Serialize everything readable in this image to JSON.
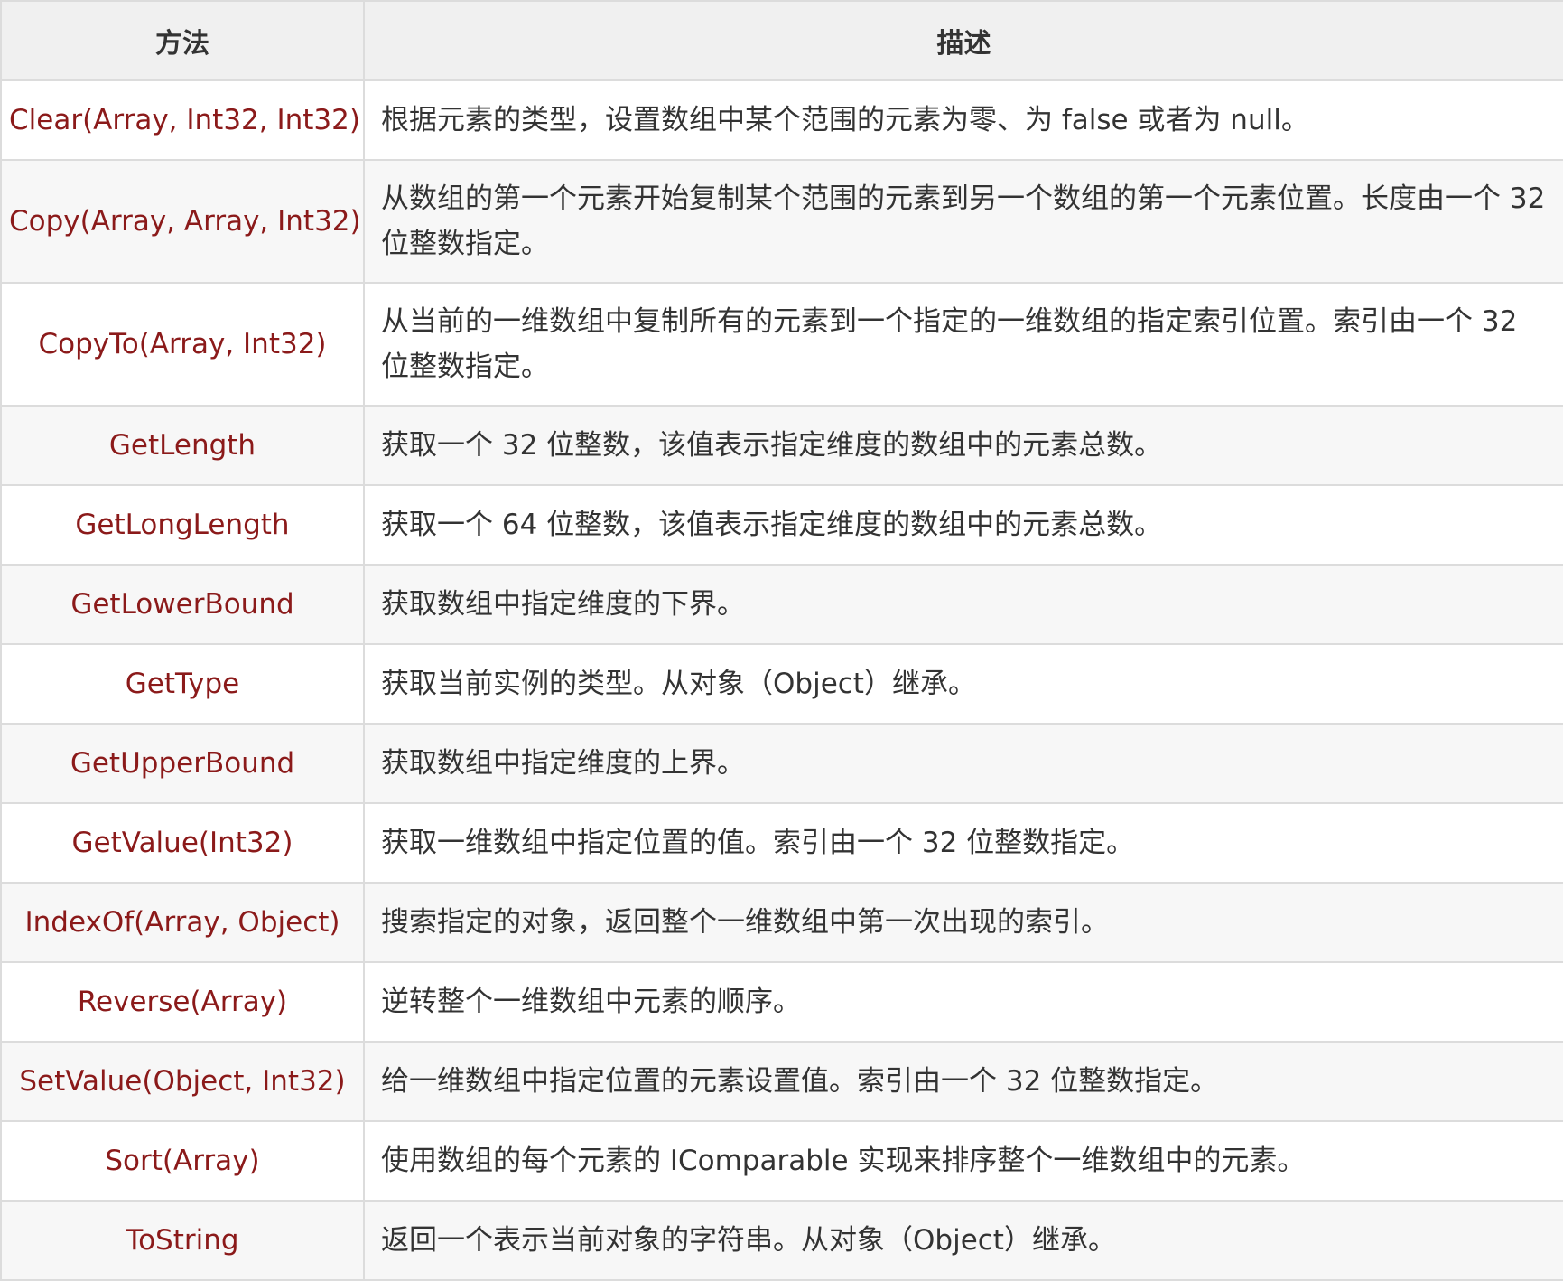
{
  "table": {
    "headers": [
      "方法",
      "描述"
    ],
    "rows": [
      {
        "method": "Clear(Array, Int32, Int32)",
        "description": "根据元素的类型，设置数组中某个范围的元素为零、为 false 或者为 null。"
      },
      {
        "method": "Copy(Array, Array, Int32)",
        "description": "从数组的第一个元素开始复制某个范围的元素到另一个数组的第一个元素位置。长度由一个 32 位整数指定。"
      },
      {
        "method": "CopyTo(Array, Int32)",
        "description": "从当前的一维数组中复制所有的元素到一个指定的一维数组的指定索引位置。索引由一个 32 位整数指定。"
      },
      {
        "method": "GetLength",
        "description": "获取一个 32 位整数，该值表示指定维度的数组中的元素总数。"
      },
      {
        "method": "GetLongLength",
        "description": "获取一个 64 位整数，该值表示指定维度的数组中的元素总数。"
      },
      {
        "method": "GetLowerBound",
        "description": "获取数组中指定维度的下界。"
      },
      {
        "method": "GetType",
        "description": "获取当前实例的类型。从对象（Object）继承。"
      },
      {
        "method": "GetUpperBound",
        "description": "获取数组中指定维度的上界。"
      },
      {
        "method": "GetValue(Int32)",
        "description": "获取一维数组中指定位置的值。索引由一个 32 位整数指定。"
      },
      {
        "method": "IndexOf(Array, Object)",
        "description": "搜索指定的对象，返回整个一维数组中第一次出现的索引。"
      },
      {
        "method": "Reverse(Array)",
        "description": "逆转整个一维数组中元素的顺序。"
      },
      {
        "method": "SetValue(Object, Int32)",
        "description": "给一维数组中指定位置的元素设置值。索引由一个 32 位整数指定。"
      },
      {
        "method": "Sort(Array)",
        "description": "使用数组的每个元素的 IComparable 实现来排序整个一维数组中的元素。"
      },
      {
        "method": "ToString",
        "description": "返回一个表示当前对象的字符串。从对象（Object）继承。"
      }
    ]
  }
}
